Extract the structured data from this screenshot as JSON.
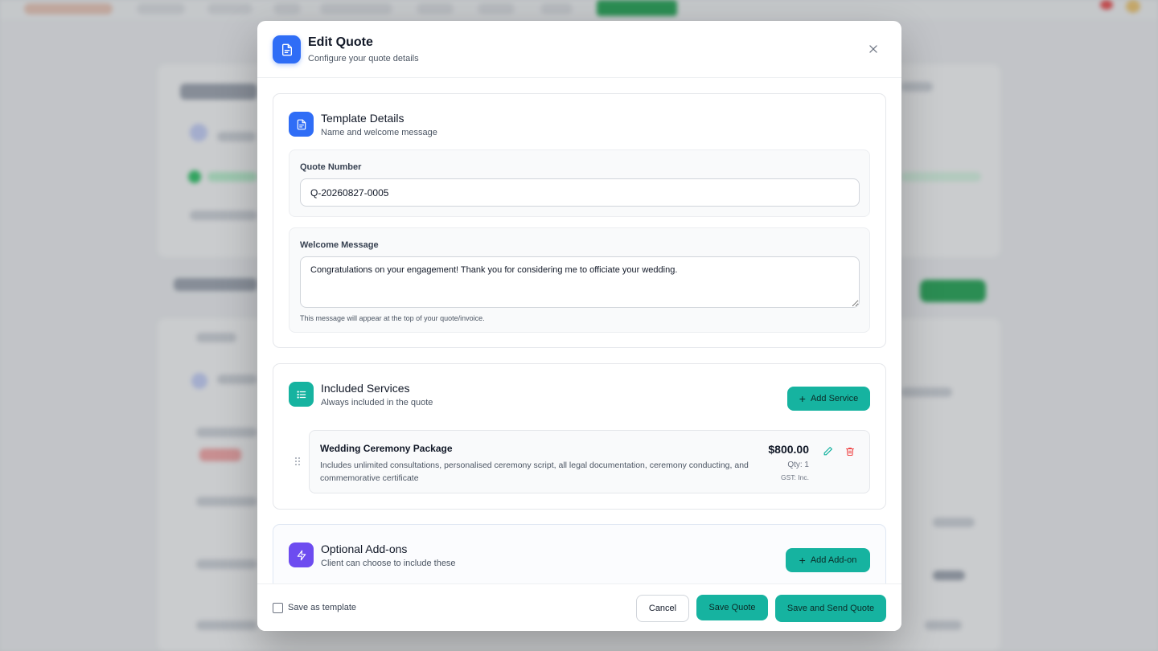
{
  "modal": {
    "title": "Edit Quote",
    "subtitle": "Configure your quote details",
    "close_icon": "close-icon"
  },
  "template_details": {
    "title": "Template Details",
    "subtitle": "Name and welcome message",
    "icon": "document-icon",
    "quote_number_label": "Quote Number",
    "quote_number_value": "Q-20260827-0005",
    "welcome_label": "Welcome Message",
    "welcome_value": "Congratulations on your engagement! Thank you for considering me to officiate your wedding.",
    "welcome_help": "This message will appear at the top of your quote/invoice."
  },
  "included_services": {
    "title": "Included Services",
    "subtitle": "Always included in the quote",
    "icon": "list-icon",
    "add_label": "Add Service",
    "items": [
      {
        "name": "Wedding Ceremony Package",
        "description": "Includes unlimited consultations, personalised ceremony script, all legal documentation, ceremony conducting, and commemorative certificate",
        "price": "$800.00",
        "qty": "Qty: 1",
        "gst": "GST: Inc."
      }
    ]
  },
  "optional_addons": {
    "title": "Optional Add-ons",
    "subtitle": "Client can choose to include these",
    "icon": "lightning-icon",
    "add_label": "Add Add-on"
  },
  "footer": {
    "save_template_label": "Save as template",
    "cancel_label": "Cancel",
    "save_label": "Save Quote",
    "save_send_label": "Save and Send Quote"
  },
  "colors": {
    "accent_teal": "#16b3a0",
    "brand_blue": "#2f6df6",
    "addon_purple": "#6d4cf0",
    "delete_red": "#ef4444"
  }
}
